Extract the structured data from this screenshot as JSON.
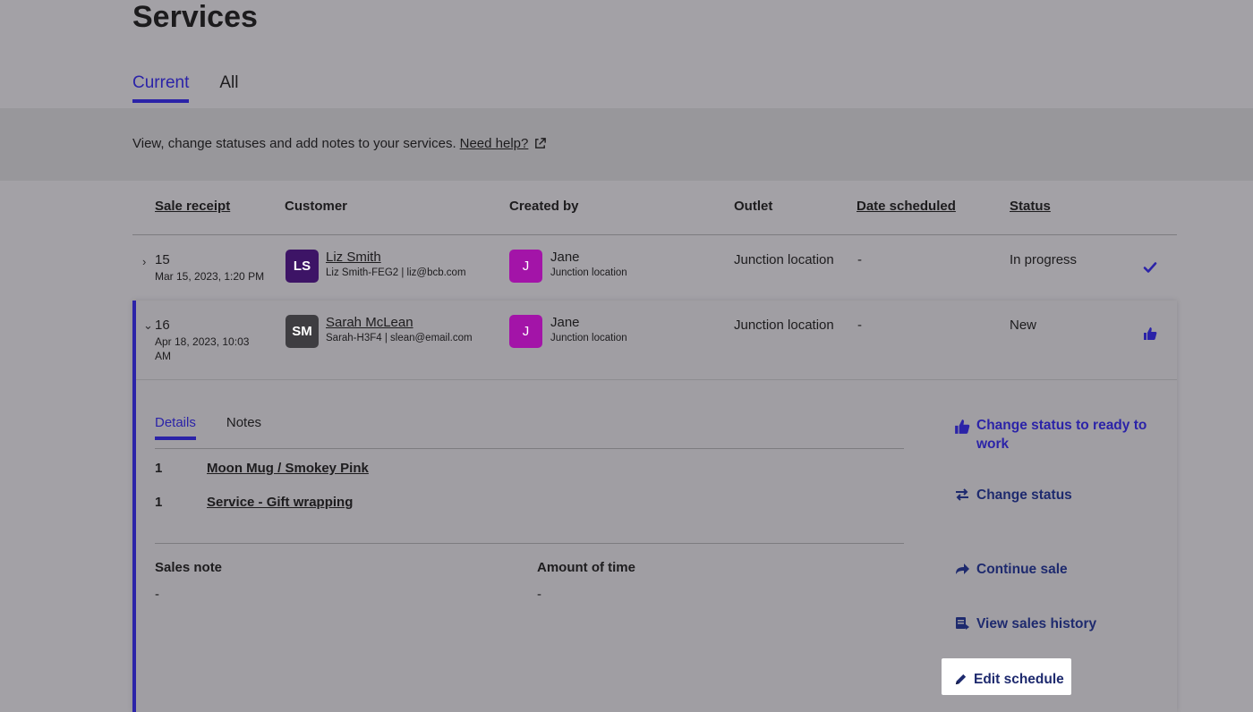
{
  "page": {
    "title": "Services"
  },
  "tabs": [
    {
      "label": "Current",
      "active": true
    },
    {
      "label": "All",
      "active": false
    }
  ],
  "help": {
    "text": "View, change statuses and add notes to your services.",
    "link": "Need help?",
    "icon": "external-link-icon"
  },
  "table": {
    "headers": {
      "receipt": "Sale receipt",
      "customer": "Customer",
      "created_by": "Created by",
      "outlet": "Outlet",
      "date": "Date scheduled",
      "status": "Status"
    },
    "rows": [
      {
        "expanded": false,
        "chevron": "›",
        "receipt": "15",
        "date": "Mar 15, 2023, 1:20 PM",
        "customer": {
          "initials": "LS",
          "name": "Liz Smith",
          "detail": "Liz Smith-FEG2 | liz@bcb.com",
          "color": "#3d1466"
        },
        "creator": {
          "initial": "J",
          "name": "Jane",
          "location": "Junction location",
          "color": "#a314a8"
        },
        "outlet": "Junction location",
        "scheduled": "-",
        "status": "In progress",
        "status_icon": "check-icon"
      },
      {
        "expanded": true,
        "chevron": "⌄",
        "receipt": "16",
        "date": "Apr 18, 2023, 10:03 AM",
        "customer": {
          "initials": "SM",
          "name": "Sarah McLean",
          "detail": "Sarah-H3F4 | slean@email.com",
          "color": "#3e3d41"
        },
        "creator": {
          "initial": "J",
          "name": "Jane",
          "location": "Junction location",
          "color": "#a314a8"
        },
        "outlet": "Junction location",
        "scheduled": "-",
        "status": "New",
        "status_icon": "thumbs-up-icon"
      }
    ]
  },
  "details": {
    "tabs": [
      {
        "label": "Details",
        "active": true
      },
      {
        "label": "Notes",
        "active": false
      }
    ],
    "items": [
      {
        "qty": "1",
        "name": "Moon Mug / Smokey Pink"
      },
      {
        "qty": "1",
        "name": "Service - Gift wrapping"
      }
    ],
    "sales_note": {
      "label": "Sales note",
      "value": "-"
    },
    "amount_of_time": {
      "label": "Amount of time",
      "value": "-"
    }
  },
  "actions": [
    {
      "label": "Change status to ready to work",
      "icon": "thumbs-up-icon"
    },
    {
      "label": "Change status",
      "icon": "swap-arrows-icon"
    },
    {
      "label": "Continue sale",
      "icon": "forward-arrow-icon"
    },
    {
      "label": "View sales history",
      "icon": "history-icon"
    },
    {
      "label": "Edit schedule",
      "icon": "pencil-icon"
    }
  ],
  "colors": {
    "accent": "#2b23a8",
    "action_text": "#1e2a6e",
    "overlay_bg": "#a3a1a6"
  }
}
